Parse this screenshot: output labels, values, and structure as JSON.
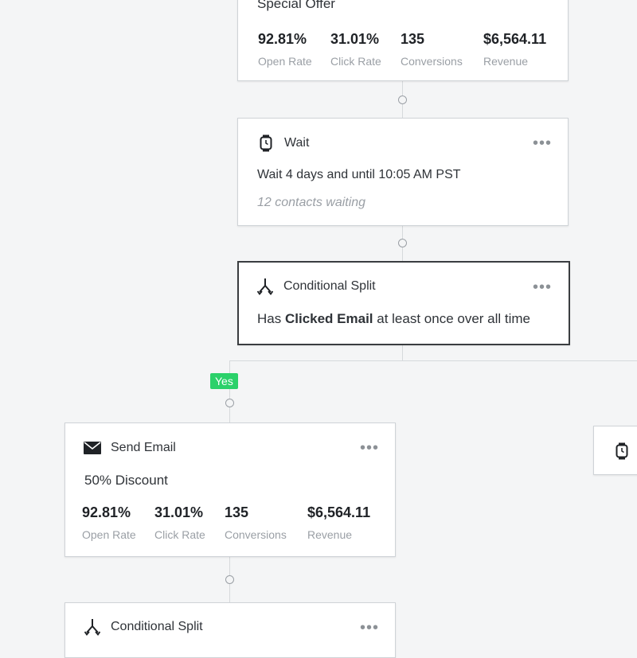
{
  "offer_card": {
    "title": "Special Offer",
    "metrics": [
      {
        "value": "92.81%",
        "label": "Open Rate"
      },
      {
        "value": "31.01%",
        "label": "Click Rate"
      },
      {
        "value": "135",
        "label": "Conversions"
      },
      {
        "value": "$6,564.11",
        "label": "Revenue"
      }
    ]
  },
  "wait_card": {
    "title": "Wait",
    "menu": "•••",
    "description": "Wait 4 days and until 10:05 AM PST",
    "status": "12 contacts waiting",
    "icon": "watch-icon"
  },
  "split_card": {
    "title": "Conditional Split",
    "menu": "•••",
    "condition_prefix": "Has ",
    "condition_bold": "Clicked Email",
    "condition_suffix": " at least once over all time",
    "icon": "split-arrows-icon"
  },
  "yes_badge": "Yes",
  "email_card": {
    "title": "Send Email",
    "menu": "•••",
    "subject": "50% Discount",
    "icon": "envelope-icon",
    "metrics": [
      {
        "value": "92.81%",
        "label": "Open Rate"
      },
      {
        "value": "31.01%",
        "label": "Click Rate"
      },
      {
        "value": "135",
        "label": "Conversions"
      },
      {
        "value": "$6,564.11",
        "label": "Revenue"
      }
    ]
  },
  "split_card_2": {
    "title": "Conditional Split",
    "menu": "•••",
    "icon": "split-arrows-icon"
  },
  "right_card": {
    "icon": "watch-icon"
  }
}
